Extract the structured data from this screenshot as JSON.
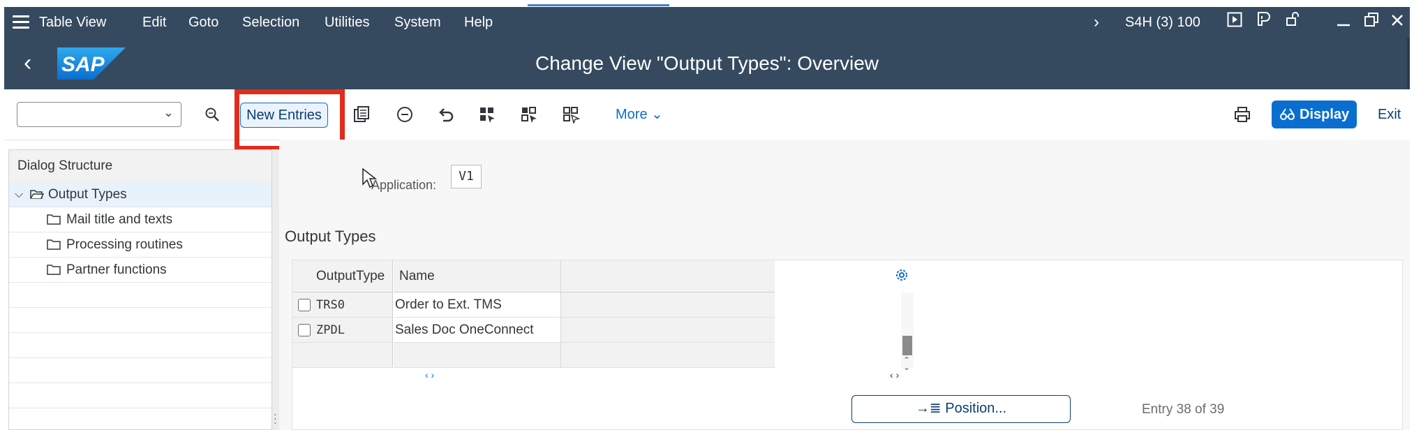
{
  "menu": {
    "items": [
      "Table View",
      "Edit",
      "Goto",
      "Selection",
      "Utilities",
      "System",
      "Help"
    ],
    "system_id": "S4H (3) 100"
  },
  "title": {
    "text": "Change View \"Output Types\": Overview",
    "logo": "SAP"
  },
  "toolbar": {
    "new_entries_label": "New Entries",
    "more_label": "More",
    "display_label": "Display",
    "exit_label": "Exit"
  },
  "dialog_structure": {
    "heading": "Dialog Structure",
    "items": [
      {
        "label": "Output Types",
        "selected": true
      },
      {
        "label": "Mail title and texts"
      },
      {
        "label": "Processing routines"
      },
      {
        "label": "Partner functions"
      }
    ]
  },
  "main": {
    "application_label": "Application:",
    "application_value": "V1",
    "section_title": "Output Types",
    "table": {
      "columns": [
        "OutputType",
        "Name"
      ],
      "rows": [
        {
          "output_type": "TRS0",
          "name": "Order to Ext. TMS"
        },
        {
          "output_type": "ZPDL",
          "name": "Sales Doc OneConnect"
        }
      ]
    },
    "position_label": "Position...",
    "entry_count": "Entry 38 of 39"
  },
  "colors": {
    "shell": "#354a5f",
    "accent": "#0a6ed1",
    "highlight": "#e32b1c"
  }
}
